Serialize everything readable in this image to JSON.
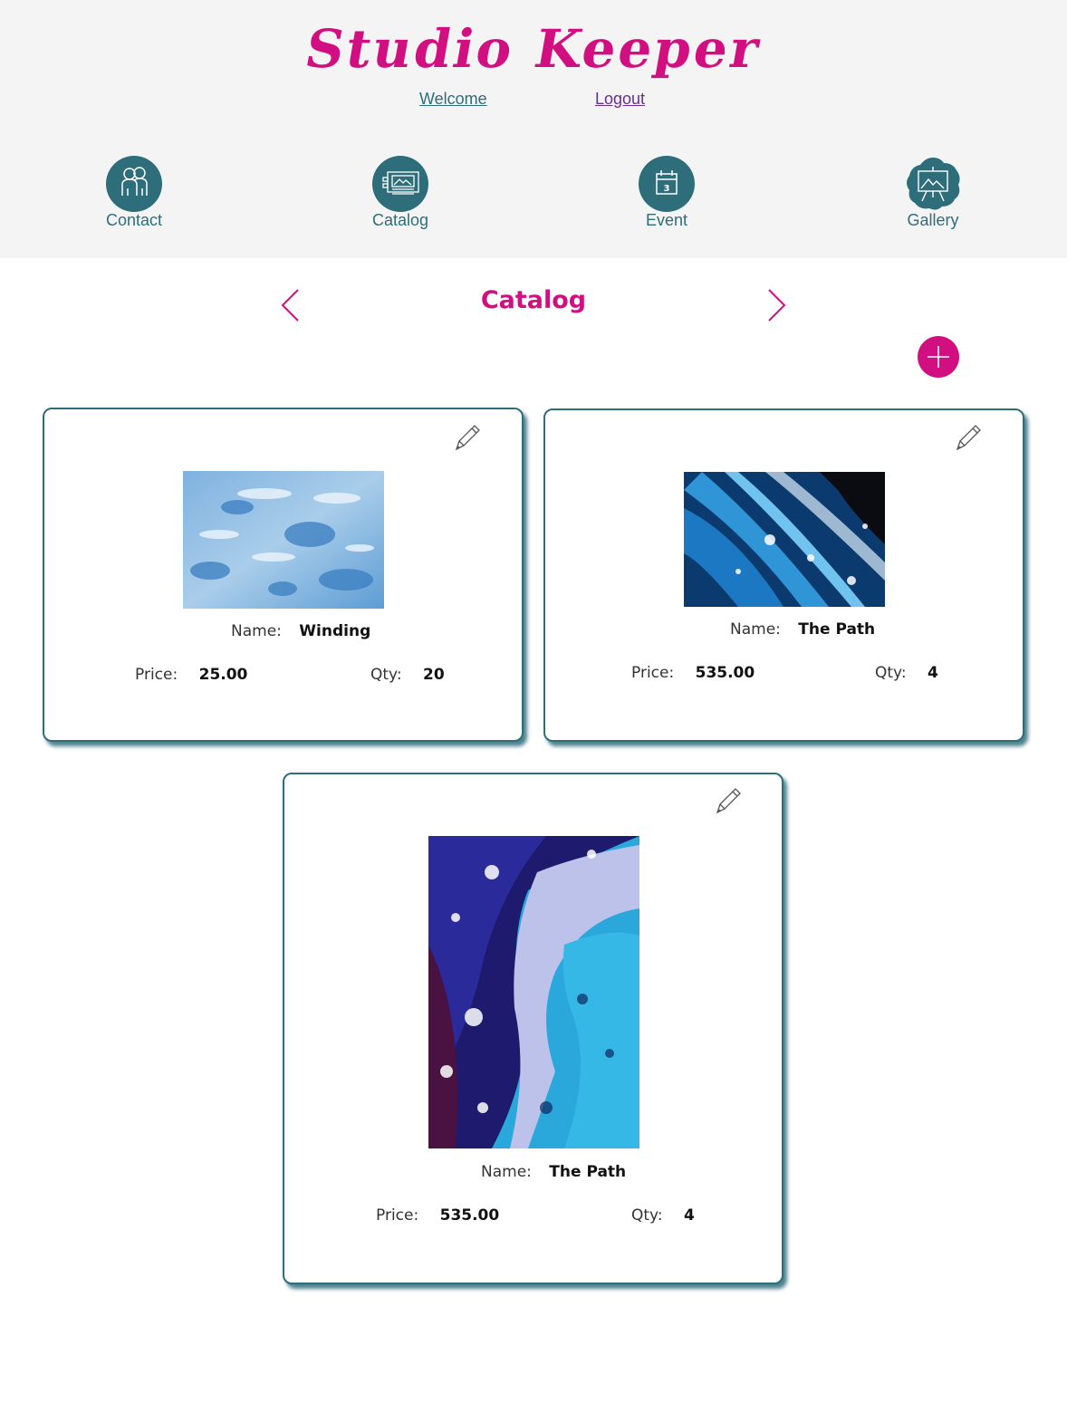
{
  "app": {
    "title": "Studio Keeper",
    "links": {
      "welcome": "Welcome",
      "logout": "Logout"
    },
    "accent": "#d10f80",
    "primary": "#2e6d7a"
  },
  "nav": {
    "items": [
      {
        "label": "Contact",
        "icon": "people-icon"
      },
      {
        "label": "Catalog",
        "icon": "catalog-frame-icon"
      },
      {
        "label": "Event",
        "icon": "calendar-icon"
      },
      {
        "label": "Gallery",
        "icon": "easel-icon"
      }
    ]
  },
  "page": {
    "title": "Catalog",
    "prev_icon": "chevron-left-icon",
    "next_icon": "chevron-right-icon",
    "add_icon": "plus-icon"
  },
  "labels": {
    "name": "Name:",
    "price": "Price:",
    "qty": "Qty:"
  },
  "items": [
    {
      "name": "Winding",
      "price": "25.00",
      "qty": "20"
    },
    {
      "name": "The Path",
      "price": "535.00",
      "qty": "4"
    },
    {
      "name": "The Path",
      "price": "535.00",
      "qty": "4"
    }
  ]
}
